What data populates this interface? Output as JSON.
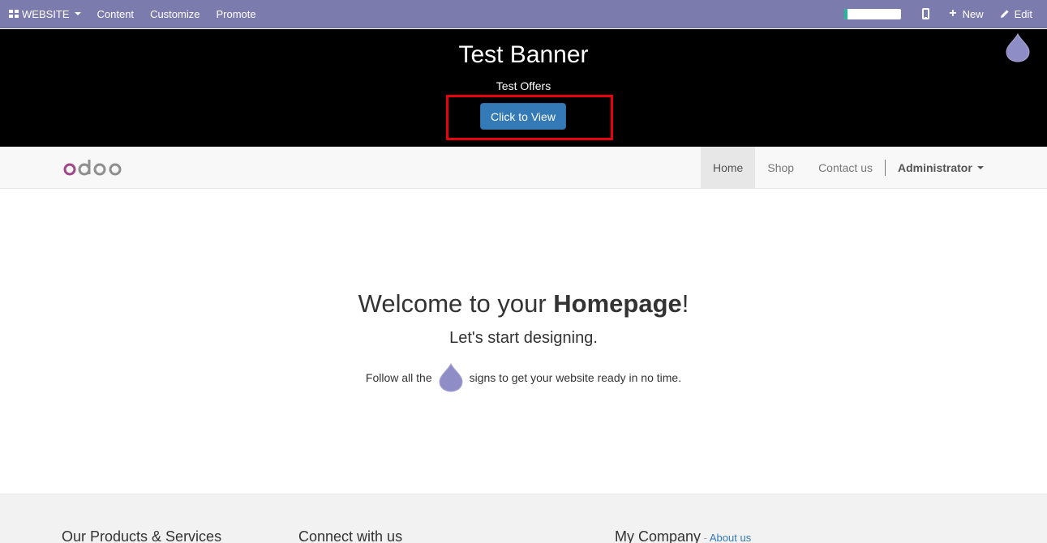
{
  "topbar": {
    "website_label": "WEBSITE",
    "menu": [
      "Content",
      "Customize",
      "Promote"
    ],
    "progress": 0.05,
    "new_label": "New",
    "edit_label": "Edit"
  },
  "banner": {
    "title": "Test Banner",
    "subtitle": "Test Offers",
    "button_label": "Click to View"
  },
  "nav": {
    "logo_text": "odoo",
    "items": [
      "Home",
      "Shop",
      "Contact us"
    ],
    "active": "Home",
    "user": "Administrator"
  },
  "main": {
    "welcome_prefix": "Welcome to your ",
    "welcome_bold": "Homepage",
    "welcome_suffix": "!",
    "start": "Let's start designing.",
    "follow_prefix": "Follow all the",
    "follow_suffix": "signs to get your website ready in no time."
  },
  "footer": {
    "col1": "Our Products & Services",
    "col2": "Connect with us",
    "col3": "My Company",
    "dash": " - ",
    "about": "About us"
  },
  "colors": {
    "topbar": "#7c7bad",
    "accent": "#337ab7",
    "highlight": "#e8000b",
    "progress": "#21b799",
    "drop": "#8f8dc6"
  }
}
